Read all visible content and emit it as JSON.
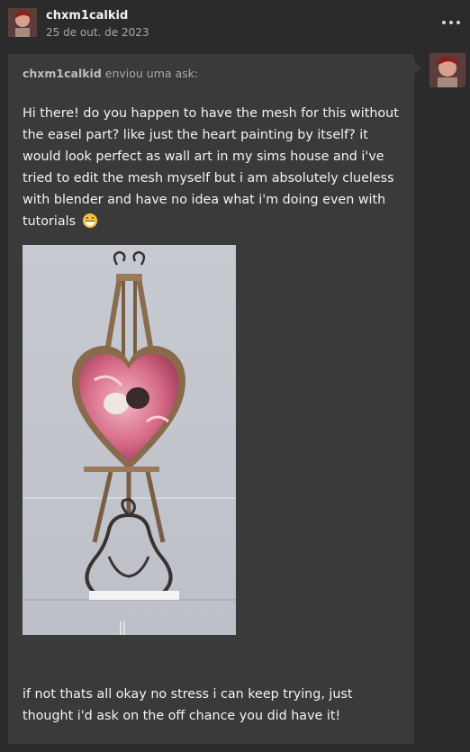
{
  "post": {
    "author": "chxm1calkid",
    "date": "25 de out. de 2023"
  },
  "ask": {
    "asker": "chxm1calkid",
    "verb": " enviou uma ask:",
    "body": "Hi there! do you happen to have the mesh for this without the easel part? like just the heart painting by itself? it would look perfect as wall art in my sims house and i've tried to edit the mesh myself but i am absolutely clueless with blender and have no idea what i'm doing even with tutorials",
    "emoji": "grinning-sweat-emoji",
    "footer": "if not thats all okay no stress i can keep trying,  just thought i'd ask on the off chance you did have it!"
  },
  "icons": {
    "more": "more-options-icon",
    "avatar": "avatar-icon"
  },
  "colors": {
    "background": "#2b2b2b",
    "card": "#3a3a3a",
    "text": "#f3f3f3",
    "muted": "#a9a9a9"
  }
}
